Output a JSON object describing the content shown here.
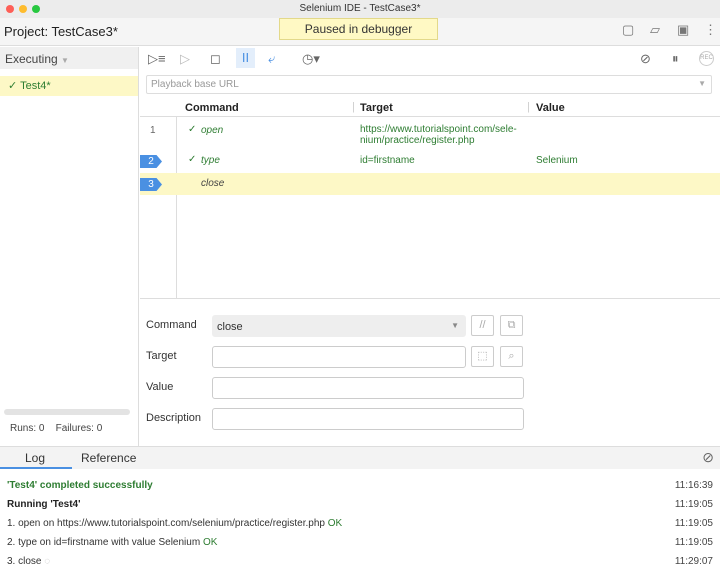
{
  "window": {
    "title": "Selenium IDE - TestCase3*"
  },
  "header": {
    "project": "Project:  TestCase3*",
    "status": "Paused in debugger"
  },
  "sidebar": {
    "dropdown": "Executing",
    "tests": [
      {
        "label": "✓ Test4*"
      }
    ],
    "runs": "Runs: 0",
    "failures": "Failures: 0"
  },
  "toolbar": {
    "url_placeholder": "Playback base URL"
  },
  "table": {
    "headers": [
      "Command",
      "Target",
      "Value"
    ],
    "rows": [
      {
        "num": "1",
        "command": "open",
        "target": "https://www.tutorialspoint.com/selenium/practice/register.php",
        "target_display": "https://www.tutorialspoint.com/sele­nium/practice/register.php",
        "value": "",
        "status": "✓"
      },
      {
        "num": "2",
        "command": "type",
        "target": "id=firstname",
        "value": "Selenium",
        "status": "✓"
      },
      {
        "num": "3",
        "command": "close",
        "target": "",
        "value": "",
        "status": ""
      }
    ]
  },
  "editor": {
    "command_label": "Command",
    "command_value": "close",
    "target_label": "Target",
    "value_label": "Value",
    "description_label": "Description"
  },
  "bottom": {
    "tabs": [
      "Log",
      "Reference"
    ],
    "log": [
      {
        "text": "'Test4' completed successfully",
        "time": "11:16:39",
        "kind": "success"
      },
      {
        "text": "Running 'Test4'",
        "time": "11:19:05",
        "kind": "bold"
      },
      {
        "text": "1.   open on https://www.tutorialspoint.com/selenium/practice/register.php",
        "ok": "OK",
        "time": "11:19:05"
      },
      {
        "text": "2.   type on id=firstname with value Selenium",
        "ok": "OK",
        "time": "11:19:05"
      },
      {
        "text": "3.   close",
        "ok": "",
        "time": "11:29:07"
      }
    ]
  },
  "colors": {
    "highlight": "#fdf8c6",
    "success": "#2e7d32",
    "accent": "#4a90e2"
  }
}
